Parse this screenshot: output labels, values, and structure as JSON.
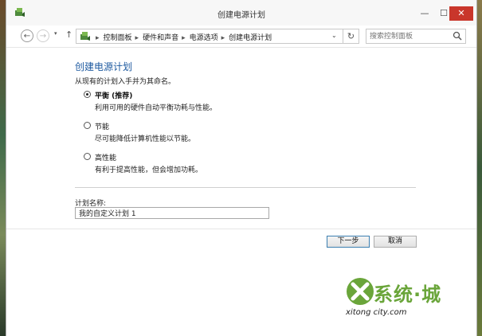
{
  "window": {
    "title": "创建电源计划",
    "app_icon": "power-options-icon"
  },
  "window_controls": {
    "minimize": "—",
    "maximize": "☐",
    "close": "✕"
  },
  "navigation": {
    "history_dropdown": "▾",
    "breadcrumbs": [
      "控制面板",
      "硬件和声音",
      "电源选项",
      "创建电源计划"
    ]
  },
  "search": {
    "placeholder": "搜索控制面板"
  },
  "main": {
    "heading": "创建电源计划",
    "intro": "从现有的计划入手并为其命名。",
    "options": [
      {
        "label": "平衡 (推荐)",
        "description": "利用可用的硬件自动平衡功耗与性能。",
        "selected": true
      },
      {
        "label": "节能",
        "description": "尽可能降低计算机性能以节能。",
        "selected": false
      },
      {
        "label": "高性能",
        "description": "有利于提高性能，但会增加功耗。",
        "selected": false
      }
    ],
    "plan_name_label": "计划名称:",
    "plan_name_value": "我的自定义计划 1"
  },
  "buttons": {
    "next": "下一步",
    "cancel": "取消"
  },
  "watermark": {
    "title": "系统·城",
    "url": "xitong city.com"
  },
  "colors": {
    "accent": "#1e5aa0",
    "close_button": "#c9362b",
    "watermark_green": "#6aa53a"
  }
}
